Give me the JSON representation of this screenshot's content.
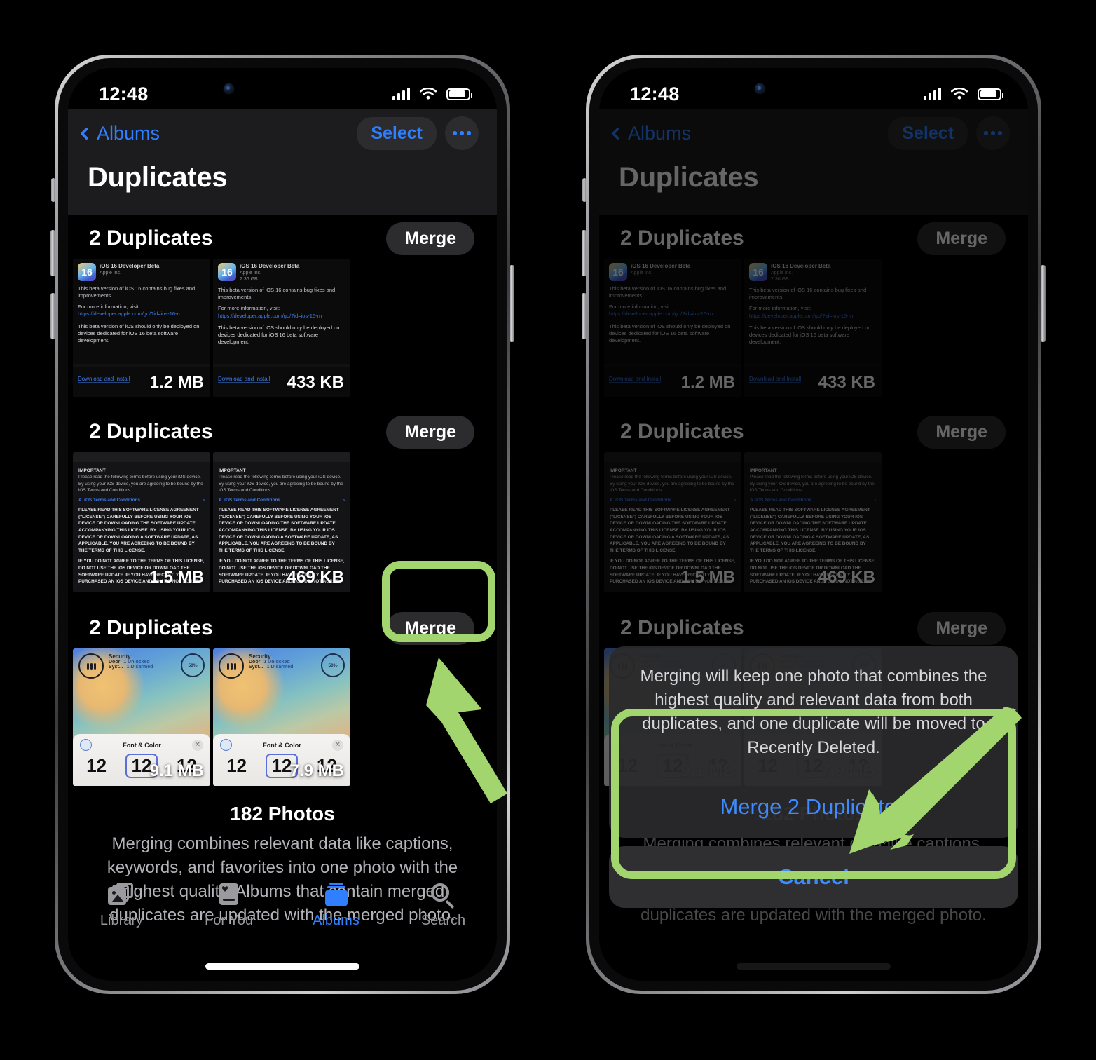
{
  "status_bar": {
    "time": "12:48",
    "signal_bars": 4,
    "signal_filled": 3,
    "wifi": "wifi-icon",
    "battery": "battery-icon"
  },
  "nav": {
    "back_label": "Albums",
    "select_label": "Select",
    "more_label": "•••",
    "title": "Duplicates"
  },
  "groups": [
    {
      "title": "2 Duplicates",
      "merge_label": "Merge",
      "kind": "release-notes",
      "photos": [
        {
          "size": "1.2 MB",
          "app_title": "iOS 16 Developer Beta",
          "app_vendor": "Apple Inc.",
          "app_size": "",
          "body1": "This beta version of iOS 16 contains bug fixes and improvements.",
          "body2": "For more information, visit:",
          "link": "https://developer.apple.com/go/?id=ios-16-rn",
          "body3": "This beta version of iOS should only be deployed on devices dedicated for iOS 16 beta software development.",
          "action": "Download and Install"
        },
        {
          "size": "433 KB",
          "app_title": "iOS 16 Developer Beta",
          "app_vendor": "Apple Inc.",
          "app_size": "2.36 GB",
          "body1": "This beta version of iOS 16 contains bug fixes and improvements.",
          "body2": "For more information, visit:",
          "link": "https://developer.apple.com/go/?id=ios-16-rn",
          "body3": "This beta version of iOS should only be deployed on devices dedicated for iOS 16 beta software development.",
          "action": "Download and Install"
        }
      ]
    },
    {
      "title": "2 Duplicates",
      "merge_label": "Merge",
      "kind": "license",
      "photos": [
        {
          "size": "1.5 MB",
          "heading": "IMPORTANT",
          "intro": "Please read the following terms before using your iOS device. By using your iOS device, you are agreeing to be bound by the iOS Terms and Conditions.",
          "link": "A. iOS Terms and Conditions",
          "para1": "PLEASE READ THIS SOFTWARE LICENSE AGREEMENT (\"LICENSE\") CAREFULLY BEFORE USING YOUR iOS DEVICE OR DOWNLOADING THE SOFTWARE UPDATE ACCOMPANYING THIS LICENSE. BY USING YOUR iOS DEVICE OR DOWNLOADING A SOFTWARE UPDATE, AS APPLICABLE, YOU ARE AGREEING TO BE BOUND BY THE TERMS OF THIS LICENSE.",
          "para2": "IF YOU DO NOT AGREE TO THE TERMS OF THIS LICENSE, DO NOT USE THE iOS DEVICE OR DOWNLOAD THE SOFTWARE UPDATE. IF YOU HAVE RECENTLY PURCHASED AN iOS DEVICE AND YOU DO NOT AGREE"
        },
        {
          "size": "469 KB",
          "heading": "IMPORTANT",
          "intro": "Please read the following terms before using your iOS device. By using your iOS device, you are agreeing to be bound by the iOS Terms and Conditions.",
          "link": "A. iOS Terms and Conditions",
          "para1": "PLEASE READ THIS SOFTWARE LICENSE AGREEMENT (\"LICENSE\") CAREFULLY BEFORE USING YOUR iOS DEVICE OR DOWNLOADING THE SOFTWARE UPDATE ACCOMPANYING THIS LICENSE. BY USING YOUR iOS DEVICE OR DOWNLOADING A SOFTWARE UPDATE, AS APPLICABLE, YOU ARE AGREEING TO BE BOUND BY THE TERMS OF THIS LICENSE.",
          "para2": "IF YOU DO NOT AGREE TO THE TERMS OF THIS LICENSE, DO NOT USE THE iOS DEVICE OR DOWNLOAD THE SOFTWARE UPDATE. IF YOU HAVE RECENTLY PURCHASED AN iOS DEVICE AND YOU DO NOT AGREE"
        }
      ]
    },
    {
      "title": "2 Duplicates",
      "merge_label": "Merge",
      "kind": "wallpaper",
      "photos": [
        {
          "size": "9.1 MB",
          "widget_title": "Security",
          "row1_label": "Door",
          "row1_value": "1 Unlocked",
          "row2_label": "Syst...",
          "row2_value": "1 Disarmed",
          "dial_value": "50%",
          "sheet_title": "Font & Color",
          "digits": [
            "12",
            "12",
            "12"
          ],
          "selected_index": 1
        },
        {
          "size": "7.9 MB",
          "widget_title": "Security",
          "row1_label": "Door",
          "row1_value": "1 Unlocked",
          "row2_label": "Syst...",
          "row2_value": "1 Disarmed",
          "dial_value": "50%",
          "sheet_title": "Font & Color",
          "digits": [
            "12",
            "12",
            "12"
          ],
          "selected_index": 1
        }
      ]
    }
  ],
  "footer": {
    "count": "182 Photos",
    "description": "Merging combines relevant data like captions, keywords, and favorites into one photo with the highest quality. Albums that contain merged duplicates are updated with the merged photo."
  },
  "tabs": [
    {
      "label": "Library",
      "icon": "photo-stack-icon",
      "active": false
    },
    {
      "label": "For You",
      "icon": "for-you-card-icon",
      "active": false
    },
    {
      "label": "Albums",
      "icon": "albums-stack-icon",
      "active": true
    },
    {
      "label": "Search",
      "icon": "magnifier-icon",
      "active": false
    }
  ],
  "action_sheet": {
    "message": "Merging will keep one photo that combines the highest quality and relevant data from both duplicates, and one duplicate will be moved to Recently Deleted.",
    "confirm_label": "Merge 2 Duplicates",
    "cancel_label": "Cancel"
  },
  "annotations": {
    "highlight_color": "#a3d56e",
    "arrow_left": "arrow-up-left-pointing-to-merge-button",
    "arrow_right": "arrow-down-left-pointing-to-merge-2-duplicates"
  }
}
